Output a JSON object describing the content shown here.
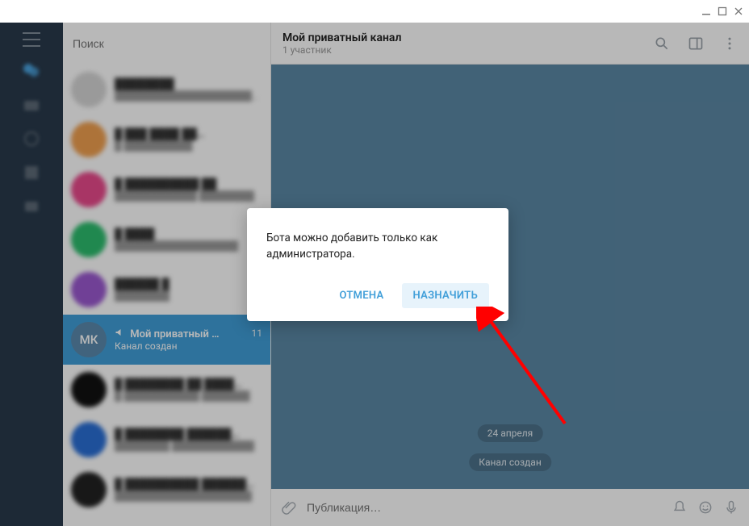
{
  "window": {
    "minimize": "_",
    "maximize": "▢",
    "close": "✕"
  },
  "search": {
    "placeholder": "Поиск"
  },
  "rail": {
    "items": [
      {
        "name": "all-chats"
      },
      {
        "name": "important"
      },
      {
        "name": "unread"
      },
      {
        "name": "channels"
      },
      {
        "name": "more"
      }
    ]
  },
  "chats": {
    "selected": {
      "avatar_text": "МК",
      "title": "Мой приватный …",
      "time": "11",
      "subtitle": "Канал создан"
    }
  },
  "conversation": {
    "title": "Мой приватный канал",
    "subtitle": "1 участник",
    "date_bubble": "24 апреля",
    "system_bubble": "Канал создан",
    "input_placeholder": "Публикация…"
  },
  "modal": {
    "message": "Бота можно добавить только как администратора.",
    "cancel": "ОТМЕНА",
    "confirm": "НАЗНАЧИТЬ"
  }
}
